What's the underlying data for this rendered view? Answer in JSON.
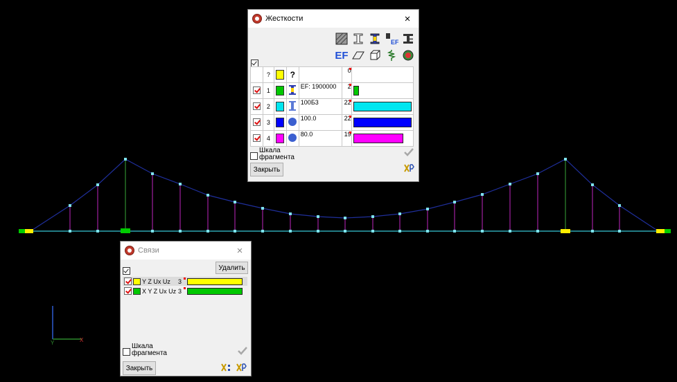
{
  "colors": {
    "background": "#000000",
    "cable": "#1f2f9c",
    "hangers": "#a020a0",
    "pylons": "#2e8b2e",
    "deck": "#37c8d6",
    "node": "#7fe3ec",
    "support_yellow": "#ffee00",
    "support_green": "#00cc00"
  },
  "axes": {
    "y_label": "Y",
    "x_label": "X"
  },
  "stiffness_dialog": {
    "title": "Жесткости",
    "close_glyph": "×",
    "toolbar_icons": [
      "cross-section-hatched-icon",
      "i-beam-icon",
      "i-beam-yellow-icon",
      "ef-section-icon",
      "steel-section-icon",
      "ef-icon",
      "plate-icon",
      "solid-icon",
      "spring-icon",
      "globe-icon"
    ],
    "ef_label": "EF",
    "rows": [
      {
        "check": "",
        "num": "?",
        "color": "#ffff00",
        "icon": "question-icon",
        "icon_glyph": "?",
        "name": "",
        "count": "0",
        "bar_color": "",
        "bar_frac": 0
      },
      {
        "check": "on",
        "num": "1",
        "color": "#00c800",
        "icon": "i-beam-yellow-icon",
        "icon_glyph": "I",
        "name": "EF: 1900000",
        "count": "2",
        "bar_color": "#00c800",
        "bar_frac": 0.1
      },
      {
        "check": "on",
        "num": "2",
        "color": "#00e6f0",
        "icon": "i-beam-icon",
        "icon_glyph": "I",
        "name": "100Б3",
        "count": "22",
        "bar_color": "#00e6f0",
        "bar_frac": 1.0
      },
      {
        "check": "on",
        "num": "3",
        "color": "#0000ff",
        "icon": "circle-section-icon",
        "icon_glyph": "",
        "name": "100.0",
        "count": "22",
        "bar_color": "#0000ff",
        "bar_frac": 1.0
      },
      {
        "check": "on",
        "num": "4",
        "color": "#ff00ff",
        "icon": "circle-section-icon",
        "icon_glyph": "",
        "name": "80.0",
        "count": "19",
        "bar_color": "#ff00ff",
        "bar_frac": 0.86
      }
    ],
    "scale_label": "Шкала\nфрагмента",
    "close_button": "Закрыть"
  },
  "links_dialog": {
    "title": "Связи",
    "close_glyph": "×",
    "delete_button": "Удалить",
    "rows": [
      {
        "color": "#ffff00",
        "label": "Y Z Ux Uz",
        "count": "3",
        "bar_color": "#ffff00"
      },
      {
        "color": "#00c800",
        "label": "X Y Z Ux Uz",
        "count": "3",
        "bar_color": "#00c800"
      }
    ],
    "scale_label": "Шкала\nфрагмента",
    "close_button": "Закрыть"
  }
}
